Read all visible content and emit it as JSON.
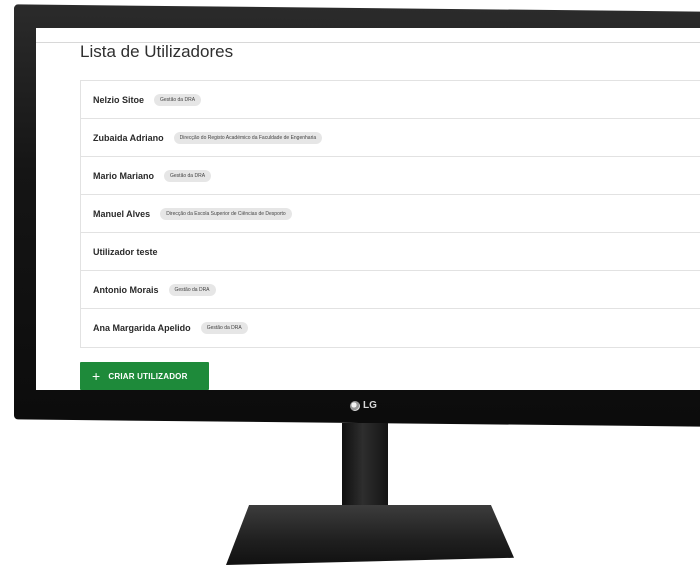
{
  "page": {
    "title": "Lista de Utilizadores"
  },
  "users": [
    {
      "name": "Nelzio Sitoe",
      "role": "Gestão da DRA"
    },
    {
      "name": "Zubaida Adriano",
      "role": "Direcção do Registo Académico da Faculdade de Engenharia"
    },
    {
      "name": "Mario Mariano",
      "role": "Gestão da DRA"
    },
    {
      "name": "Manuel Alves",
      "role": "Direcção da Escola Superior de Ciências de Desporto"
    },
    {
      "name": "Utilizador teste",
      "role": ""
    },
    {
      "name": "Antonio Morais",
      "role": "Gestão da DRA"
    },
    {
      "name": "Ana Margarida Apelido",
      "role": "Gestão da DRA"
    }
  ],
  "actions": {
    "create_user_label": "CRIAR UTILIZADOR",
    "create_user_icon": "plus-icon"
  },
  "monitor": {
    "brand": "LG"
  },
  "colors": {
    "accent": "#1e8a3a"
  }
}
